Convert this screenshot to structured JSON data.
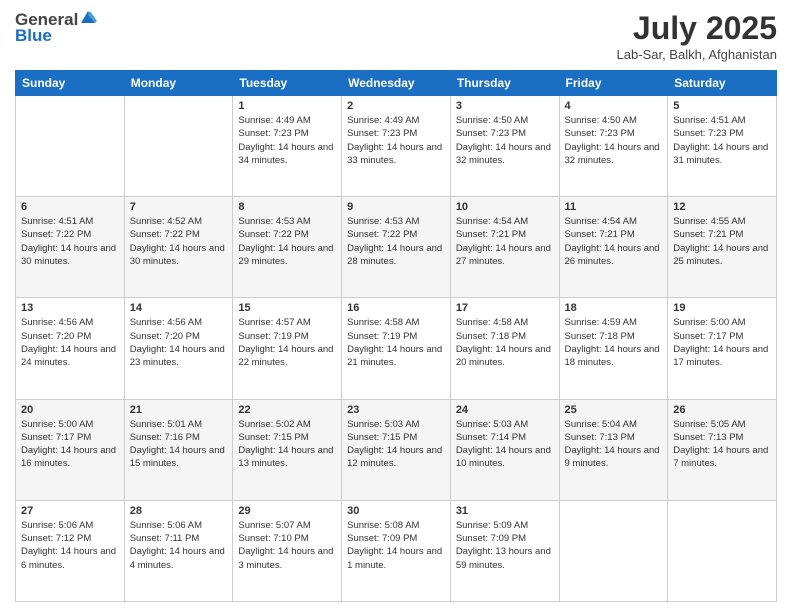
{
  "header": {
    "logo_general": "General",
    "logo_blue": "Blue",
    "month": "July 2025",
    "location": "Lab-Sar, Balkh, Afghanistan"
  },
  "days_of_week": [
    "Sunday",
    "Monday",
    "Tuesday",
    "Wednesday",
    "Thursday",
    "Friday",
    "Saturday"
  ],
  "weeks": [
    [
      {
        "day": "",
        "sunrise": "",
        "sunset": "",
        "daylight": ""
      },
      {
        "day": "",
        "sunrise": "",
        "sunset": "",
        "daylight": ""
      },
      {
        "day": "1",
        "sunrise": "Sunrise: 4:49 AM",
        "sunset": "Sunset: 7:23 PM",
        "daylight": "Daylight: 14 hours and 34 minutes."
      },
      {
        "day": "2",
        "sunrise": "Sunrise: 4:49 AM",
        "sunset": "Sunset: 7:23 PM",
        "daylight": "Daylight: 14 hours and 33 minutes."
      },
      {
        "day": "3",
        "sunrise": "Sunrise: 4:50 AM",
        "sunset": "Sunset: 7:23 PM",
        "daylight": "Daylight: 14 hours and 32 minutes."
      },
      {
        "day": "4",
        "sunrise": "Sunrise: 4:50 AM",
        "sunset": "Sunset: 7:23 PM",
        "daylight": "Daylight: 14 hours and 32 minutes."
      },
      {
        "day": "5",
        "sunrise": "Sunrise: 4:51 AM",
        "sunset": "Sunset: 7:23 PM",
        "daylight": "Daylight: 14 hours and 31 minutes."
      }
    ],
    [
      {
        "day": "6",
        "sunrise": "Sunrise: 4:51 AM",
        "sunset": "Sunset: 7:22 PM",
        "daylight": "Daylight: 14 hours and 30 minutes."
      },
      {
        "day": "7",
        "sunrise": "Sunrise: 4:52 AM",
        "sunset": "Sunset: 7:22 PM",
        "daylight": "Daylight: 14 hours and 30 minutes."
      },
      {
        "day": "8",
        "sunrise": "Sunrise: 4:53 AM",
        "sunset": "Sunset: 7:22 PM",
        "daylight": "Daylight: 14 hours and 29 minutes."
      },
      {
        "day": "9",
        "sunrise": "Sunrise: 4:53 AM",
        "sunset": "Sunset: 7:22 PM",
        "daylight": "Daylight: 14 hours and 28 minutes."
      },
      {
        "day": "10",
        "sunrise": "Sunrise: 4:54 AM",
        "sunset": "Sunset: 7:21 PM",
        "daylight": "Daylight: 14 hours and 27 minutes."
      },
      {
        "day": "11",
        "sunrise": "Sunrise: 4:54 AM",
        "sunset": "Sunset: 7:21 PM",
        "daylight": "Daylight: 14 hours and 26 minutes."
      },
      {
        "day": "12",
        "sunrise": "Sunrise: 4:55 AM",
        "sunset": "Sunset: 7:21 PM",
        "daylight": "Daylight: 14 hours and 25 minutes."
      }
    ],
    [
      {
        "day": "13",
        "sunrise": "Sunrise: 4:56 AM",
        "sunset": "Sunset: 7:20 PM",
        "daylight": "Daylight: 14 hours and 24 minutes."
      },
      {
        "day": "14",
        "sunrise": "Sunrise: 4:56 AM",
        "sunset": "Sunset: 7:20 PM",
        "daylight": "Daylight: 14 hours and 23 minutes."
      },
      {
        "day": "15",
        "sunrise": "Sunrise: 4:57 AM",
        "sunset": "Sunset: 7:19 PM",
        "daylight": "Daylight: 14 hours and 22 minutes."
      },
      {
        "day": "16",
        "sunrise": "Sunrise: 4:58 AM",
        "sunset": "Sunset: 7:19 PM",
        "daylight": "Daylight: 14 hours and 21 minutes."
      },
      {
        "day": "17",
        "sunrise": "Sunrise: 4:58 AM",
        "sunset": "Sunset: 7:18 PM",
        "daylight": "Daylight: 14 hours and 20 minutes."
      },
      {
        "day": "18",
        "sunrise": "Sunrise: 4:59 AM",
        "sunset": "Sunset: 7:18 PM",
        "daylight": "Daylight: 14 hours and 18 minutes."
      },
      {
        "day": "19",
        "sunrise": "Sunrise: 5:00 AM",
        "sunset": "Sunset: 7:17 PM",
        "daylight": "Daylight: 14 hours and 17 minutes."
      }
    ],
    [
      {
        "day": "20",
        "sunrise": "Sunrise: 5:00 AM",
        "sunset": "Sunset: 7:17 PM",
        "daylight": "Daylight: 14 hours and 16 minutes."
      },
      {
        "day": "21",
        "sunrise": "Sunrise: 5:01 AM",
        "sunset": "Sunset: 7:16 PM",
        "daylight": "Daylight: 14 hours and 15 minutes."
      },
      {
        "day": "22",
        "sunrise": "Sunrise: 5:02 AM",
        "sunset": "Sunset: 7:15 PM",
        "daylight": "Daylight: 14 hours and 13 minutes."
      },
      {
        "day": "23",
        "sunrise": "Sunrise: 5:03 AM",
        "sunset": "Sunset: 7:15 PM",
        "daylight": "Daylight: 14 hours and 12 minutes."
      },
      {
        "day": "24",
        "sunrise": "Sunrise: 5:03 AM",
        "sunset": "Sunset: 7:14 PM",
        "daylight": "Daylight: 14 hours and 10 minutes."
      },
      {
        "day": "25",
        "sunrise": "Sunrise: 5:04 AM",
        "sunset": "Sunset: 7:13 PM",
        "daylight": "Daylight: 14 hours and 9 minutes."
      },
      {
        "day": "26",
        "sunrise": "Sunrise: 5:05 AM",
        "sunset": "Sunset: 7:13 PM",
        "daylight": "Daylight: 14 hours and 7 minutes."
      }
    ],
    [
      {
        "day": "27",
        "sunrise": "Sunrise: 5:06 AM",
        "sunset": "Sunset: 7:12 PM",
        "daylight": "Daylight: 14 hours and 6 minutes."
      },
      {
        "day": "28",
        "sunrise": "Sunrise: 5:06 AM",
        "sunset": "Sunset: 7:11 PM",
        "daylight": "Daylight: 14 hours and 4 minutes."
      },
      {
        "day": "29",
        "sunrise": "Sunrise: 5:07 AM",
        "sunset": "Sunset: 7:10 PM",
        "daylight": "Daylight: 14 hours and 3 minutes."
      },
      {
        "day": "30",
        "sunrise": "Sunrise: 5:08 AM",
        "sunset": "Sunset: 7:09 PM",
        "daylight": "Daylight: 14 hours and 1 minute."
      },
      {
        "day": "31",
        "sunrise": "Sunrise: 5:09 AM",
        "sunset": "Sunset: 7:09 PM",
        "daylight": "Daylight: 13 hours and 59 minutes."
      },
      {
        "day": "",
        "sunrise": "",
        "sunset": "",
        "daylight": ""
      },
      {
        "day": "",
        "sunrise": "",
        "sunset": "",
        "daylight": ""
      }
    ]
  ]
}
